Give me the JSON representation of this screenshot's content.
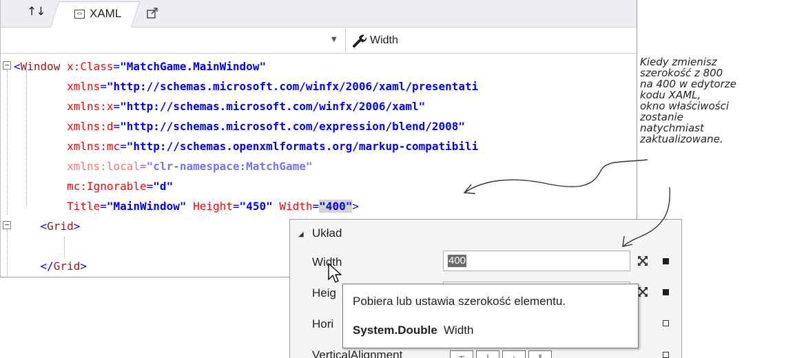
{
  "tabs": {
    "swap_glyph": "↑↓",
    "xaml_label": "XAML"
  },
  "navbar": {
    "member": "Width"
  },
  "code": {
    "lines": [
      {
        "parts": [
          [
            "br",
            "<"
          ],
          [
            "tag",
            "Window"
          ],
          [
            "plain",
            " "
          ],
          [
            "attr",
            "x:Class"
          ],
          [
            "br",
            "="
          ],
          [
            "val",
            "\"MatchGame.MainWindow\""
          ]
        ]
      },
      {
        "parts": [
          [
            "plain",
            "        "
          ],
          [
            "attr",
            "xmlns"
          ],
          [
            "br",
            "="
          ],
          [
            "val",
            "\"http://schemas.microsoft.com/winfx/2006/xaml/presentati"
          ]
        ]
      },
      {
        "parts": [
          [
            "plain",
            "        "
          ],
          [
            "attr",
            "xmlns:x"
          ],
          [
            "br",
            "="
          ],
          [
            "val",
            "\"http://schemas.microsoft.com/winfx/2006/xaml\""
          ]
        ]
      },
      {
        "parts": [
          [
            "plain",
            "        "
          ],
          [
            "attr",
            "xmlns:d"
          ],
          [
            "br",
            "="
          ],
          [
            "val",
            "\"http://schemas.microsoft.com/expression/blend/2008\""
          ]
        ]
      },
      {
        "parts": [
          [
            "plain",
            "        "
          ],
          [
            "attr",
            "xmlns:mc"
          ],
          [
            "br",
            "="
          ],
          [
            "val",
            "\"http://schemas.openxmlformats.org/markup-compatibili"
          ]
        ]
      },
      {
        "dim": true,
        "parts": [
          [
            "plain",
            "        "
          ],
          [
            "attr",
            "xmlns:local"
          ],
          [
            "br",
            "="
          ],
          [
            "val",
            "\"clr-namespace:MatchGame\""
          ]
        ]
      },
      {
        "parts": [
          [
            "plain",
            "        "
          ],
          [
            "attr",
            "mc:Ignorable"
          ],
          [
            "br",
            "="
          ],
          [
            "val",
            "\"d\""
          ]
        ]
      },
      {
        "parts": [
          [
            "plain",
            "        "
          ],
          [
            "attr",
            "Title"
          ],
          [
            "br",
            "="
          ],
          [
            "val",
            "\"MainWindow\""
          ],
          [
            "plain",
            " "
          ],
          [
            "attr",
            "Height"
          ],
          [
            "br",
            "="
          ],
          [
            "val",
            "\"450\""
          ],
          [
            "plain",
            " "
          ],
          [
            "attr",
            "Width"
          ],
          [
            "br",
            "="
          ],
          [
            "valhl",
            "\"400\""
          ],
          [
            "br",
            ">"
          ]
        ]
      },
      {
        "parts": [
          [
            "plain",
            "    "
          ],
          [
            "br",
            "<"
          ],
          [
            "tag",
            "Grid"
          ],
          [
            "br",
            ">"
          ]
        ]
      },
      {
        "parts": [
          [
            "plain",
            ""
          ]
        ]
      },
      {
        "parts": [
          [
            "plain",
            "    "
          ],
          [
            "br",
            "</"
          ],
          [
            "tag",
            "Grid"
          ],
          [
            "br",
            ">"
          ]
        ]
      }
    ]
  },
  "properties": {
    "section": "Układ",
    "width_label": "Width",
    "width_value": "400",
    "height_label": "Heig",
    "horizontal_label": "Hori",
    "vertical_label": "VerticalAlignment"
  },
  "tooltip": {
    "description": "Pobiera lub ustawia szerokość elementu.",
    "type": "System.Double",
    "name": "Width"
  },
  "annotation": {
    "lines": [
      "Kiedy zmienisz",
      "szerokość z 800",
      "na 400 w edytorze",
      "kodu XAML,",
      "okno właściwości",
      "zostanie",
      "natychmiast",
      "zaktualizowane."
    ]
  }
}
